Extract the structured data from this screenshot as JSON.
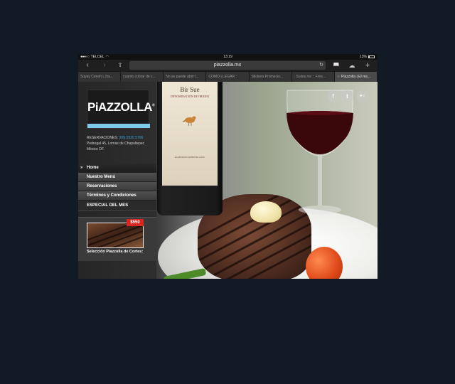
{
  "status_bar": {
    "signal": "●●●○○",
    "carrier": "TELCEL",
    "time": "13:19",
    "battery": "13%",
    "battery_level": 0.13
  },
  "toolbar": {
    "back": "‹",
    "forward": "›",
    "share": "⇪",
    "url": "piazzolla.mx",
    "reload": "↻",
    "bookmarks": "📖",
    "cloud": "☁",
    "new_tab": "+"
  },
  "tabs": [
    {
      "label": "Suyay Cenoh | Joy..."
    },
    {
      "label": "cuanto cobrar de c..."
    },
    {
      "label": "No se puede abrir l..."
    },
    {
      "label": "COMO LLEGAR :"
    },
    {
      "label": "Stickers Promocio..."
    },
    {
      "label": ": Sutsis.mx :: Free..."
    },
    {
      "label": "Piazzolla | El res...",
      "active": true
    }
  ],
  "bottle": {
    "brand": "Bir Sue",
    "subtitle": "DENOMINACIÓN DE ORIGEN",
    "small": "ELABORADO EMBOTELLADO"
  },
  "social": {
    "facebook": "f",
    "twitter": "t",
    "flickr": "●○"
  },
  "sidebar": {
    "logo": "PiAZZOLLA",
    "logo_mark": "®",
    "reservations_label": "RESERVACIONES:",
    "reservations_phone": "(55) 5520 5706",
    "address_line1": "Pedregal 45, Lomas de Chapultepec",
    "address_line2": "México DF.",
    "menu": [
      {
        "label": "Home"
      },
      {
        "label": "Nuestro Menú"
      },
      {
        "label": "Reservaciones"
      },
      {
        "label": "Términos y Condiciones"
      }
    ],
    "home_arrow": "»",
    "special_title": "ESPECIAL DEL MES",
    "promo_price": "$550",
    "promo_caption": "Selección Piazzolla de Cortes:"
  }
}
